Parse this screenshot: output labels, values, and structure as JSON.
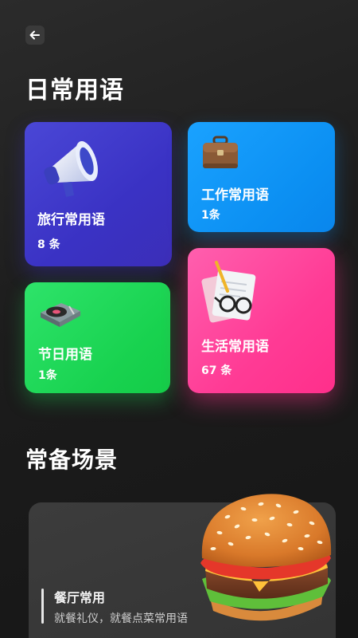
{
  "header": {
    "back_icon": "arrow-left-icon"
  },
  "sections": {
    "daily_title": "日常用语",
    "scenes_title": "常备场景"
  },
  "categories": [
    {
      "name": "旅行常用语",
      "count": "8 条",
      "icon": "megaphone-icon",
      "color": "#3f3acb"
    },
    {
      "name": "工作常用语",
      "count": "1条",
      "icon": "briefcase-icon",
      "color": "#0f95f5"
    },
    {
      "name": "节日用语",
      "count": "1条",
      "icon": "turntable-icon",
      "color": "#1fd657"
    },
    {
      "name": "生活常用语",
      "count": "67 条",
      "icon": "documents-glasses-icon",
      "color": "#ff3d96"
    }
  ],
  "scenes": [
    {
      "name": "餐厅常用",
      "description": "就餐礼仪，就餐点菜常用语",
      "icon": "burger-icon"
    }
  ]
}
